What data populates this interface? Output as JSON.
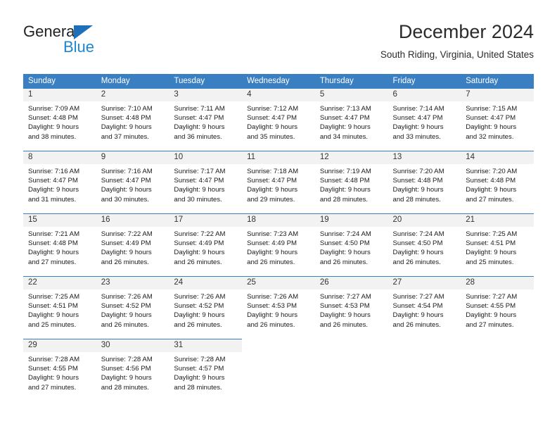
{
  "brand": {
    "name_part1": "General",
    "name_part2": "Blue",
    "triangle_color": "#1e6fba",
    "blue_color": "#1e86d0"
  },
  "header": {
    "month_title": "December 2024",
    "location": "South Riding, Virginia, United States"
  },
  "theme": {
    "header_bg": "#3a7fc1",
    "daynum_bg": "#f2f2f2",
    "cell_border": "#3a7fc1",
    "text": "#1a1a1a"
  },
  "weekday_headers": [
    "Sunday",
    "Monday",
    "Tuesday",
    "Wednesday",
    "Thursday",
    "Friday",
    "Saturday"
  ],
  "weeks": [
    [
      {
        "day": "1",
        "sunrise": "Sunrise: 7:09 AM",
        "sunset": "Sunset: 4:48 PM",
        "daylight1": "Daylight: 9 hours",
        "daylight2": "and 38 minutes."
      },
      {
        "day": "2",
        "sunrise": "Sunrise: 7:10 AM",
        "sunset": "Sunset: 4:48 PM",
        "daylight1": "Daylight: 9 hours",
        "daylight2": "and 37 minutes."
      },
      {
        "day": "3",
        "sunrise": "Sunrise: 7:11 AM",
        "sunset": "Sunset: 4:47 PM",
        "daylight1": "Daylight: 9 hours",
        "daylight2": "and 36 minutes."
      },
      {
        "day": "4",
        "sunrise": "Sunrise: 7:12 AM",
        "sunset": "Sunset: 4:47 PM",
        "daylight1": "Daylight: 9 hours",
        "daylight2": "and 35 minutes."
      },
      {
        "day": "5",
        "sunrise": "Sunrise: 7:13 AM",
        "sunset": "Sunset: 4:47 PM",
        "daylight1": "Daylight: 9 hours",
        "daylight2": "and 34 minutes."
      },
      {
        "day": "6",
        "sunrise": "Sunrise: 7:14 AM",
        "sunset": "Sunset: 4:47 PM",
        "daylight1": "Daylight: 9 hours",
        "daylight2": "and 33 minutes."
      },
      {
        "day": "7",
        "sunrise": "Sunrise: 7:15 AM",
        "sunset": "Sunset: 4:47 PM",
        "daylight1": "Daylight: 9 hours",
        "daylight2": "and 32 minutes."
      }
    ],
    [
      {
        "day": "8",
        "sunrise": "Sunrise: 7:16 AM",
        "sunset": "Sunset: 4:47 PM",
        "daylight1": "Daylight: 9 hours",
        "daylight2": "and 31 minutes."
      },
      {
        "day": "9",
        "sunrise": "Sunrise: 7:16 AM",
        "sunset": "Sunset: 4:47 PM",
        "daylight1": "Daylight: 9 hours",
        "daylight2": "and 30 minutes."
      },
      {
        "day": "10",
        "sunrise": "Sunrise: 7:17 AM",
        "sunset": "Sunset: 4:47 PM",
        "daylight1": "Daylight: 9 hours",
        "daylight2": "and 30 minutes."
      },
      {
        "day": "11",
        "sunrise": "Sunrise: 7:18 AM",
        "sunset": "Sunset: 4:47 PM",
        "daylight1": "Daylight: 9 hours",
        "daylight2": "and 29 minutes."
      },
      {
        "day": "12",
        "sunrise": "Sunrise: 7:19 AM",
        "sunset": "Sunset: 4:48 PM",
        "daylight1": "Daylight: 9 hours",
        "daylight2": "and 28 minutes."
      },
      {
        "day": "13",
        "sunrise": "Sunrise: 7:20 AM",
        "sunset": "Sunset: 4:48 PM",
        "daylight1": "Daylight: 9 hours",
        "daylight2": "and 28 minutes."
      },
      {
        "day": "14",
        "sunrise": "Sunrise: 7:20 AM",
        "sunset": "Sunset: 4:48 PM",
        "daylight1": "Daylight: 9 hours",
        "daylight2": "and 27 minutes."
      }
    ],
    [
      {
        "day": "15",
        "sunrise": "Sunrise: 7:21 AM",
        "sunset": "Sunset: 4:48 PM",
        "daylight1": "Daylight: 9 hours",
        "daylight2": "and 27 minutes."
      },
      {
        "day": "16",
        "sunrise": "Sunrise: 7:22 AM",
        "sunset": "Sunset: 4:49 PM",
        "daylight1": "Daylight: 9 hours",
        "daylight2": "and 26 minutes."
      },
      {
        "day": "17",
        "sunrise": "Sunrise: 7:22 AM",
        "sunset": "Sunset: 4:49 PM",
        "daylight1": "Daylight: 9 hours",
        "daylight2": "and 26 minutes."
      },
      {
        "day": "18",
        "sunrise": "Sunrise: 7:23 AM",
        "sunset": "Sunset: 4:49 PM",
        "daylight1": "Daylight: 9 hours",
        "daylight2": "and 26 minutes."
      },
      {
        "day": "19",
        "sunrise": "Sunrise: 7:24 AM",
        "sunset": "Sunset: 4:50 PM",
        "daylight1": "Daylight: 9 hours",
        "daylight2": "and 26 minutes."
      },
      {
        "day": "20",
        "sunrise": "Sunrise: 7:24 AM",
        "sunset": "Sunset: 4:50 PM",
        "daylight1": "Daylight: 9 hours",
        "daylight2": "and 26 minutes."
      },
      {
        "day": "21",
        "sunrise": "Sunrise: 7:25 AM",
        "sunset": "Sunset: 4:51 PM",
        "daylight1": "Daylight: 9 hours",
        "daylight2": "and 25 minutes."
      }
    ],
    [
      {
        "day": "22",
        "sunrise": "Sunrise: 7:25 AM",
        "sunset": "Sunset: 4:51 PM",
        "daylight1": "Daylight: 9 hours",
        "daylight2": "and 25 minutes."
      },
      {
        "day": "23",
        "sunrise": "Sunrise: 7:26 AM",
        "sunset": "Sunset: 4:52 PM",
        "daylight1": "Daylight: 9 hours",
        "daylight2": "and 26 minutes."
      },
      {
        "day": "24",
        "sunrise": "Sunrise: 7:26 AM",
        "sunset": "Sunset: 4:52 PM",
        "daylight1": "Daylight: 9 hours",
        "daylight2": "and 26 minutes."
      },
      {
        "day": "25",
        "sunrise": "Sunrise: 7:26 AM",
        "sunset": "Sunset: 4:53 PM",
        "daylight1": "Daylight: 9 hours",
        "daylight2": "and 26 minutes."
      },
      {
        "day": "26",
        "sunrise": "Sunrise: 7:27 AM",
        "sunset": "Sunset: 4:53 PM",
        "daylight1": "Daylight: 9 hours",
        "daylight2": "and 26 minutes."
      },
      {
        "day": "27",
        "sunrise": "Sunrise: 7:27 AM",
        "sunset": "Sunset: 4:54 PM",
        "daylight1": "Daylight: 9 hours",
        "daylight2": "and 26 minutes."
      },
      {
        "day": "28",
        "sunrise": "Sunrise: 7:27 AM",
        "sunset": "Sunset: 4:55 PM",
        "daylight1": "Daylight: 9 hours",
        "daylight2": "and 27 minutes."
      }
    ],
    [
      {
        "day": "29",
        "sunrise": "Sunrise: 7:28 AM",
        "sunset": "Sunset: 4:55 PM",
        "daylight1": "Daylight: 9 hours",
        "daylight2": "and 27 minutes."
      },
      {
        "day": "30",
        "sunrise": "Sunrise: 7:28 AM",
        "sunset": "Sunset: 4:56 PM",
        "daylight1": "Daylight: 9 hours",
        "daylight2": "and 28 minutes."
      },
      {
        "day": "31",
        "sunrise": "Sunrise: 7:28 AM",
        "sunset": "Sunset: 4:57 PM",
        "daylight1": "Daylight: 9 hours",
        "daylight2": "and 28 minutes."
      },
      {
        "day": "",
        "sunrise": "",
        "sunset": "",
        "daylight1": "",
        "daylight2": ""
      },
      {
        "day": "",
        "sunrise": "",
        "sunset": "",
        "daylight1": "",
        "daylight2": ""
      },
      {
        "day": "",
        "sunrise": "",
        "sunset": "",
        "daylight1": "",
        "daylight2": ""
      },
      {
        "day": "",
        "sunrise": "",
        "sunset": "",
        "daylight1": "",
        "daylight2": ""
      }
    ]
  ]
}
